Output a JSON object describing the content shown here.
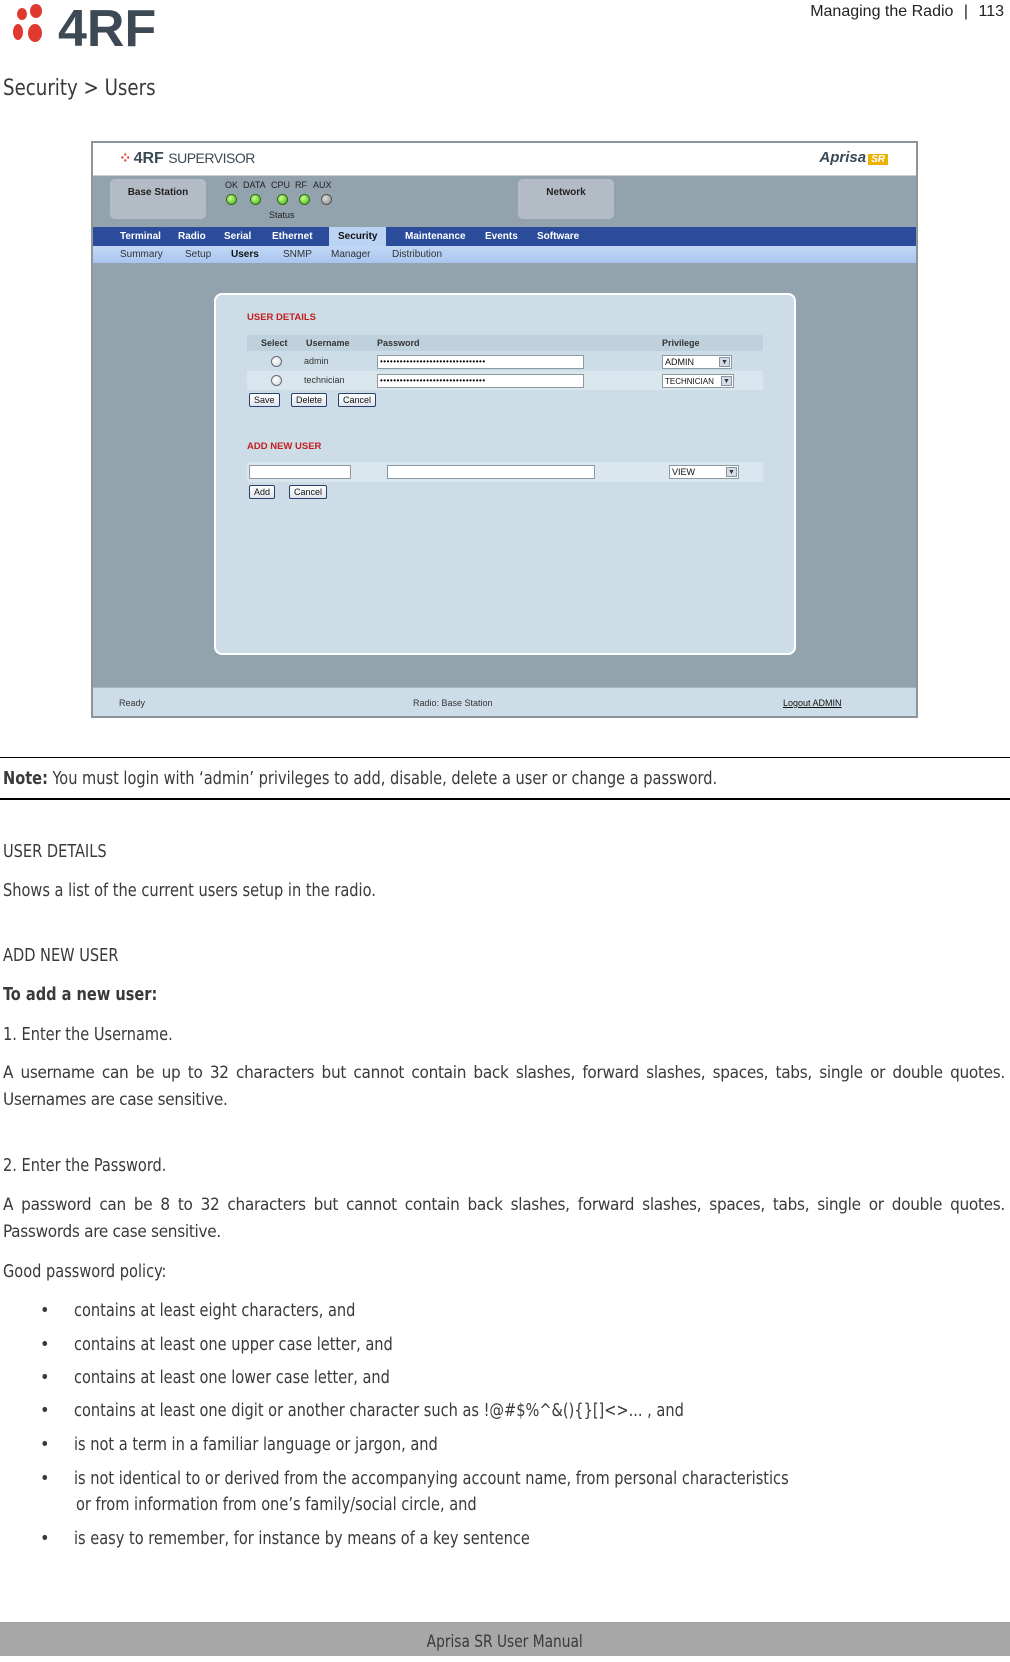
{
  "page_header": {
    "section": "Managing the Radio",
    "separator": "|",
    "page_number": "113"
  },
  "logo": {
    "text": "4RF",
    "icon": "4rf-dots-logo-icon",
    "brand_color": "#e0392f"
  },
  "section_title": "Security > Users",
  "app": {
    "brand": "4RF",
    "product": "SUPERVISOR",
    "product_logo": "Aprisa",
    "product_badge": "SR",
    "station_box": "Base Station",
    "network_box": "Network",
    "leds": [
      {
        "label": "OK",
        "state": "on"
      },
      {
        "label": "DATA",
        "state": "on"
      },
      {
        "label": "CPU",
        "state": "on"
      },
      {
        "label": "RF",
        "state": "on"
      },
      {
        "label": "AUX",
        "state": "off"
      }
    ],
    "status_label": "Status",
    "main_tabs": [
      "Terminal",
      "Radio",
      "Serial",
      "Ethernet",
      "Security",
      "Maintenance",
      "Events",
      "Software"
    ],
    "active_main_tab": "Security",
    "sub_tabs": [
      "Summary",
      "Setup",
      "Users",
      "SNMP",
      "Manager",
      "Distribution"
    ],
    "active_sub_tab": "Users",
    "user_details": {
      "heading": "USER DETAILS",
      "columns": [
        "Select",
        "Username",
        "Password",
        "Privilege"
      ],
      "rows": [
        {
          "username": "admin",
          "password": "••••••••••••••••••••••••••••••••",
          "privilege": "ADMIN"
        },
        {
          "username": "technician",
          "password": "••••••••••••••••••••••••••••••••",
          "privilege": "TECHNICIAN"
        }
      ],
      "buttons": [
        "Save",
        "Delete",
        "Cancel"
      ]
    },
    "add_new_user": {
      "heading": "ADD NEW USER",
      "username_value": "",
      "password_value": "",
      "privilege": "VIEW",
      "buttons": [
        "Add",
        "Cancel"
      ]
    },
    "status_bar": {
      "left": "Ready",
      "center": "Radio: Base Station",
      "right": "Logout ADMIN"
    },
    "colors": {
      "nav": "#2b4b9b",
      "heading_red": "#c41d1d",
      "panel": "#cddde7",
      "background": "#93a3ad"
    }
  },
  "note": {
    "label": "Note:",
    "text": " You must login with ‘admin’ privileges to add, disable, delete a user or change a password."
  },
  "doc": {
    "user_details_heading": "USER DETAILS",
    "user_details_text": "Shows a list of the current users setup in the radio.",
    "add_new_user_heading": "ADD NEW USER",
    "procedure_title": "To add a new user:",
    "step1": "1.   Enter the Username.",
    "step1_text": "A username can be up to 32 characters but cannot contain back slashes, forward slashes, spaces, tabs, single or double quotes. Usernames are case sensitive.",
    "step2": "2.   Enter the Password.",
    "step2_text": "A password can be 8 to 32 characters but cannot contain back slashes, forward slashes, spaces, tabs, single or double quotes. Passwords are case sensitive.",
    "policy_title": "Good password policy:",
    "policy_items": [
      "contains at least eight characters, and",
      "contains at least one upper case letter, and",
      "contains at least one lower case letter, and",
      "contains at least one digit or another character such as  !@#$%^&(){}[]<>... , and",
      "is not a term in a familiar language or jargon, and",
      "is not identical to or derived from the accompanying account name, from personal characteristics",
      "is easy to remember, for instance by means of a key sentence"
    ],
    "policy_item6_cont": "or from information from one’s family/social circle, and"
  },
  "footer": "Aprisa SR User Manual"
}
